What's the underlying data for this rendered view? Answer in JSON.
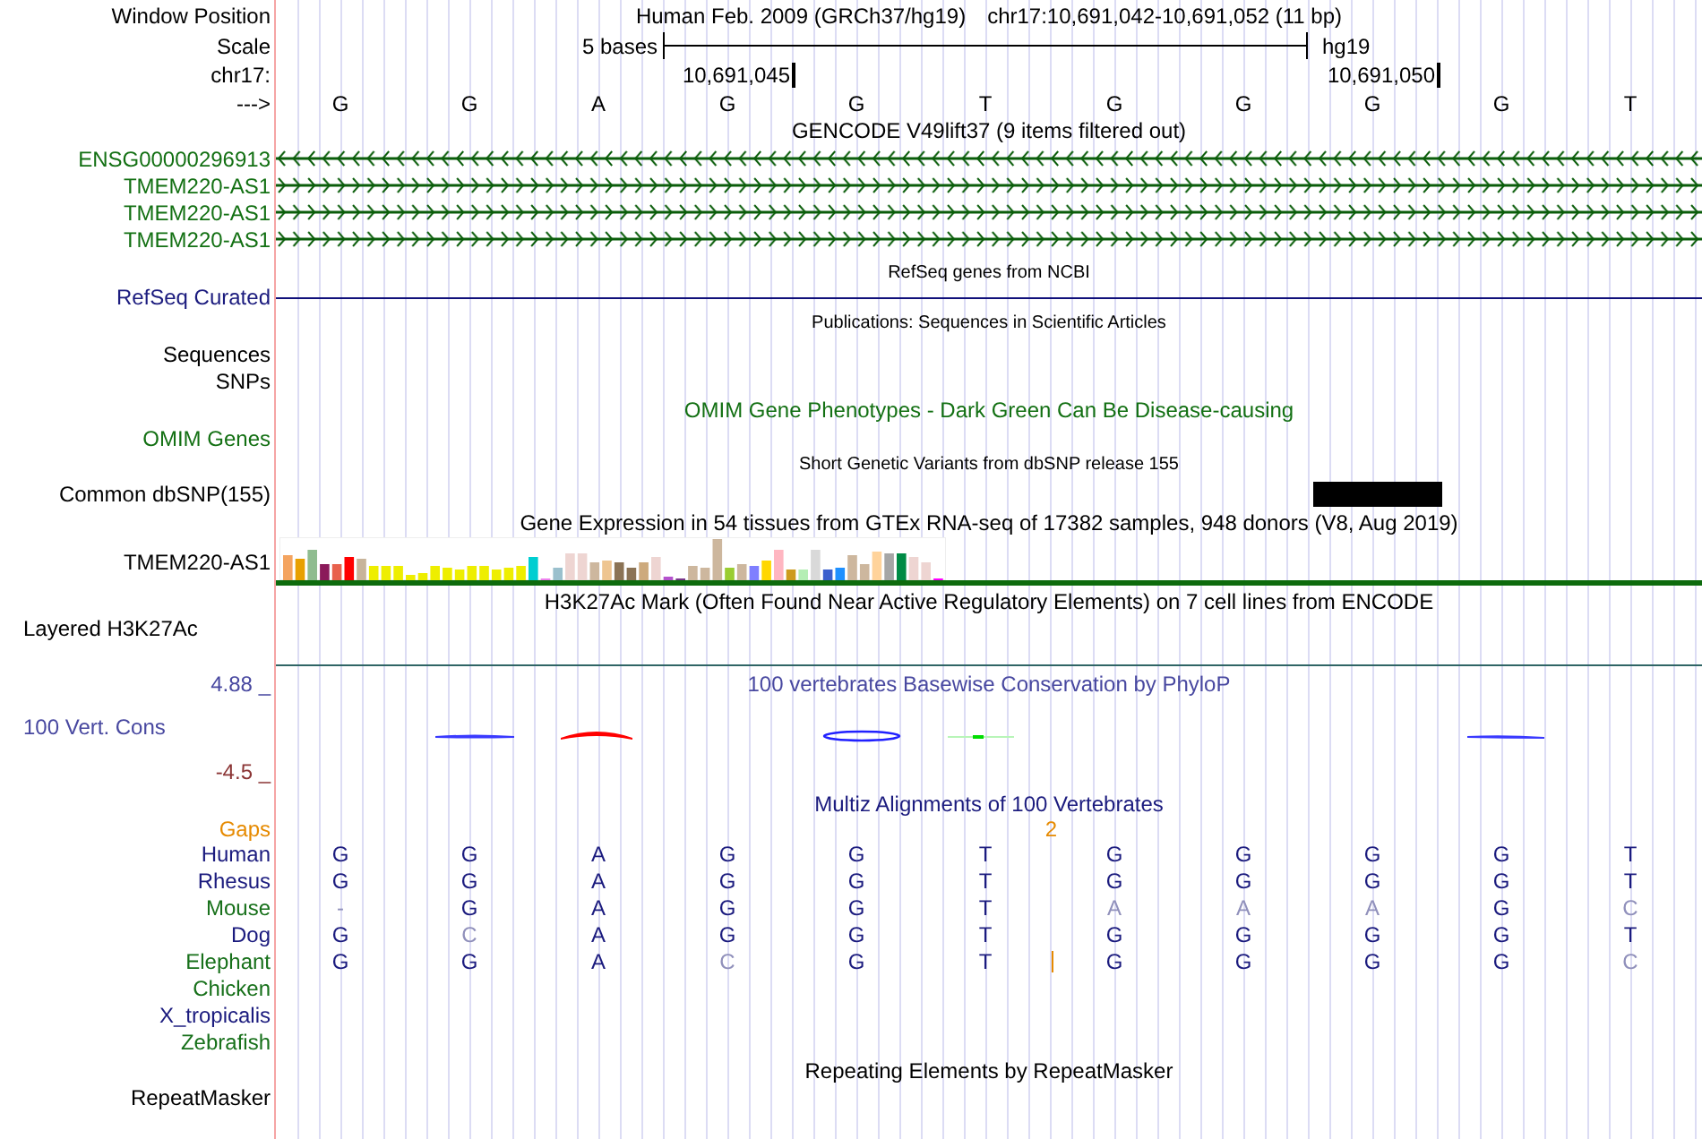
{
  "position": {
    "label": "Window Position",
    "assembly": "Human Feb. 2009 (GRCh37/hg19)",
    "range": "chr17:10,691,042-10,691,052 (11 bp)"
  },
  "scale": {
    "label": "Scale",
    "length": "5 bases",
    "assembly": "hg19"
  },
  "ruler": {
    "label": "chr17:"
  },
  "sequence": {
    "label": "--->",
    "bases": [
      {
        "base": "G"
      },
      {
        "base": "G"
      },
      {
        "base": "A"
      },
      {
        "base": "G",
        "coordinate": "10,691,045"
      },
      {
        "base": "G"
      },
      {
        "base": "T"
      },
      {
        "base": "G"
      },
      {
        "base": "G"
      },
      {
        "base": "G",
        "coordinate": "10,691,050"
      },
      {
        "base": "G"
      },
      {
        "base": "T"
      }
    ]
  },
  "gencode": {
    "title": "GENCODE V49lift37 (9 items filtered out)",
    "genes": [
      {
        "name": "ENSG00000296913",
        "kind": "reverse"
      },
      {
        "name": "TMEM220-AS1",
        "kind": "forward"
      },
      {
        "name": "TMEM220-AS1",
        "kind": "forward"
      },
      {
        "name": "TMEM220-AS1",
        "kind": "forward"
      }
    ]
  },
  "refseq": {
    "title": "RefSeq genes from NCBI",
    "label": "RefSeq Curated"
  },
  "publications": {
    "title": "Publications: Sequences in Scientific Articles",
    "labels": [
      "Sequences",
      "SNPs"
    ]
  },
  "omim": {
    "title": "OMIM Gene Phenotypes - Dark Green Can Be Disease-causing",
    "label": "OMIM Genes"
  },
  "dbsnp": {
    "title": "Short Genetic Variants from dbSNP release 155",
    "label": "Common dbSNP(155)"
  },
  "gtex": {
    "title": "Gene Expression in 54 tissues from GTEx RNA-seq of 17382 samples, 948 donors (V8, Aug 2019)",
    "label": "TMEM220-AS1"
  },
  "h3k27ac": {
    "title": "H3K27Ac Mark (Often Found Near Active Regulatory Elements) on 7 cell lines from ENCODE",
    "label": "Layered H3K27Ac"
  },
  "conservation": {
    "title": "100 vertebrates Basewise Conservation by PhyloP",
    "label": "100 Vert. Cons",
    "max": "4.88 _",
    "min": "-4.5 _"
  },
  "multiz": {
    "title": "Multiz Alignments of 100 Vertebrates",
    "gaps_label": "Gaps",
    "gap_columns": [
      {},
      {},
      {},
      {},
      {},
      {
        "count": "2"
      },
      {},
      {},
      {},
      {},
      {}
    ],
    "species": [
      {
        "name": "Human",
        "color": "#1b1b7e",
        "bases": [
          {
            "b": "G",
            "match": true
          },
          {
            "b": "G",
            "match": true
          },
          {
            "b": "A",
            "match": true
          },
          {
            "b": "G",
            "match": true
          },
          {
            "b": "G",
            "match": true
          },
          {
            "b": "T",
            "match": true
          },
          {
            "b": "G",
            "match": true
          },
          {
            "b": "G",
            "match": true
          },
          {
            "b": "G",
            "match": true
          },
          {
            "b": "G",
            "match": true
          },
          {
            "b": "T",
            "match": true
          }
        ]
      },
      {
        "name": "Rhesus",
        "color": "#1b1b7e",
        "bases": [
          {
            "b": "G",
            "match": true
          },
          {
            "b": "G",
            "match": true
          },
          {
            "b": "A",
            "match": true
          },
          {
            "b": "G",
            "match": true
          },
          {
            "b": "G",
            "match": true
          },
          {
            "b": "T",
            "match": true
          },
          {
            "b": "G",
            "match": true
          },
          {
            "b": "G",
            "match": true
          },
          {
            "b": "G",
            "match": true
          },
          {
            "b": "G",
            "match": true
          },
          {
            "b": "T",
            "match": true
          }
        ]
      },
      {
        "name": "Mouse",
        "color": "#17701a",
        "bases": [
          {
            "b": "-",
            "match": false
          },
          {
            "b": "G",
            "match": true
          },
          {
            "b": "A",
            "match": true
          },
          {
            "b": "G",
            "match": true
          },
          {
            "b": "G",
            "match": true
          },
          {
            "b": "T",
            "match": true
          },
          {
            "b": "A",
            "match": false
          },
          {
            "b": "A",
            "match": false
          },
          {
            "b": "A",
            "match": false
          },
          {
            "b": "G",
            "match": true
          },
          {
            "b": "C",
            "match": false
          }
        ]
      },
      {
        "name": "Dog",
        "color": "#1b1b7e",
        "bases": [
          {
            "b": "G",
            "match": true
          },
          {
            "b": "C",
            "match": false
          },
          {
            "b": "A",
            "match": true
          },
          {
            "b": "G",
            "match": true
          },
          {
            "b": "G",
            "match": true
          },
          {
            "b": "T",
            "match": true
          },
          {
            "b": "G",
            "match": true
          },
          {
            "b": "G",
            "match": true
          },
          {
            "b": "G",
            "match": true
          },
          {
            "b": "G",
            "match": true
          },
          {
            "b": "T",
            "match": true
          }
        ]
      },
      {
        "name": "Elephant",
        "color": "#17701a",
        "bases": [
          {
            "b": "G",
            "match": true
          },
          {
            "b": "G",
            "match": true
          },
          {
            "b": "A",
            "match": true
          },
          {
            "b": "C",
            "match": false
          },
          {
            "b": "G",
            "match": true
          },
          {
            "b": "T",
            "match": true,
            "insertion": true
          },
          {
            "b": "G",
            "match": true
          },
          {
            "b": "G",
            "match": true
          },
          {
            "b": "G",
            "match": true
          },
          {
            "b": "G",
            "match": true
          },
          {
            "b": "C",
            "match": false
          }
        ]
      },
      {
        "name": "Chicken",
        "color": "#17701a"
      },
      {
        "name": "X_tropicalis",
        "color": "#1b1b7e"
      },
      {
        "name": "Zebrafish",
        "color": "#17701a"
      }
    ]
  },
  "repeatmasker": {
    "title": "Repeating Elements by RepeatMasker",
    "label": "RepeatMasker"
  }
}
